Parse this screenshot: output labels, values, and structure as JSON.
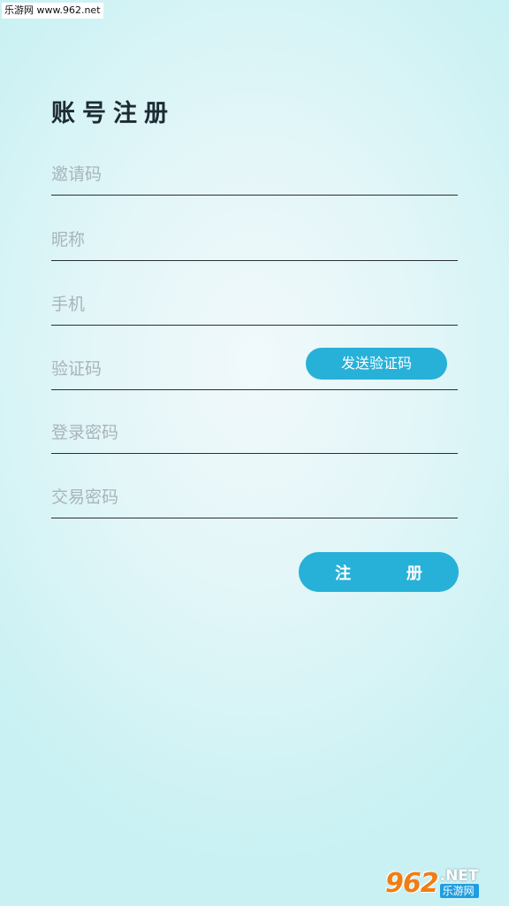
{
  "watermark": {
    "top_text": "乐游网 www.962.net"
  },
  "page": {
    "title": "账号注册"
  },
  "fields": [
    {
      "key": "invite_code",
      "placeholder": "邀请码",
      "value": ""
    },
    {
      "key": "nickname",
      "placeholder": "昵称",
      "value": ""
    },
    {
      "key": "phone",
      "placeholder": "手机",
      "value": ""
    },
    {
      "key": "verify_code",
      "placeholder": "验证码",
      "value": ""
    },
    {
      "key": "login_password",
      "placeholder": "登录密码",
      "value": ""
    },
    {
      "key": "trade_password",
      "placeholder": "交易密码",
      "value": ""
    }
  ],
  "buttons": {
    "send_code": "发送验证码",
    "register_left": "注",
    "register_right": "册"
  },
  "logo": {
    "number": "962",
    "suffix": ".NET",
    "cn": "乐游网"
  },
  "colors": {
    "accent": "#27b1d8",
    "title": "#1d2b33",
    "placeholder": "#a9b4b9",
    "divider": "#2b2f33"
  }
}
